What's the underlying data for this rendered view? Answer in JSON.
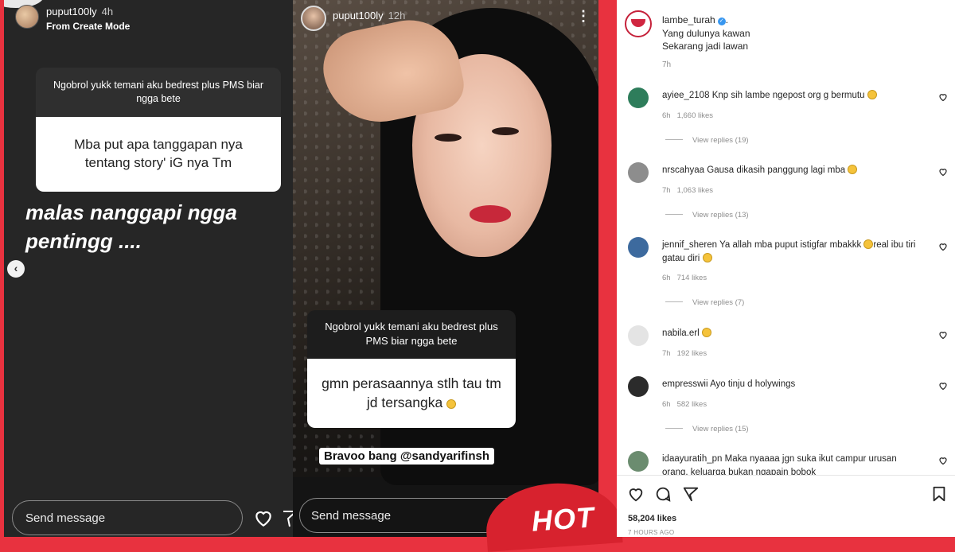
{
  "story_left": {
    "username": "puput100ly",
    "time": "4h",
    "subtitle": "From Create Mode",
    "question_prompt": "Ngobrol yukk temani aku bedrest plus PMS biar ngga bete",
    "question_answer": "Mba put apa tanggapan nya tentang story' iG nya Tm",
    "caption": "malas nanggapi ngga pentingg ....",
    "prev_arrow": "‹",
    "send_placeholder": "Send message"
  },
  "story_middle": {
    "username": "puput100ly",
    "time": "12h",
    "more": "⋮",
    "question_prompt": "Ngobrol yukk temani aku bedrest plus PMS biar ngga bete",
    "question_answer": "gmn perasaannya stlh tau tm jd tersangka",
    "mention": "Bravoo bang @sandyarifinsh",
    "send_placeholder": "Send message",
    "badge": "HOT"
  },
  "post": {
    "username": "lambe_turah",
    "verified_mark": "✓",
    "caption_dot": ".",
    "caption_lines": [
      "Yang dulunya kawan",
      "Sekarang jadi lawan"
    ],
    "time": "7h",
    "comments": [
      {
        "user": "ayiee_2108",
        "text": "Knp sih lambe ngepost org g bermutu",
        "emoji": true,
        "time": "6h",
        "likes": "1,660 likes",
        "replies": "View replies (19)",
        "avatar_color": "#2e7d5b"
      },
      {
        "user": "nrscahyaa",
        "text": "Gausa dikasih panggung lagi mba",
        "emoji": true,
        "time": "7h",
        "likes": "1,063 likes",
        "replies": "View replies (13)",
        "avatar_color": "#8d8d8d"
      },
      {
        "user": "jennif_sheren",
        "text": "Ya allah mba puput istigfar mbakkk",
        "text2": "real ibu tiri gatau diri",
        "emoji": true,
        "time": "6h",
        "likes": "714 likes",
        "replies": "View replies (7)",
        "avatar_color": "#3d6a9e"
      },
      {
        "user": "nabila.erl",
        "text": "",
        "emoji": true,
        "time": "7h",
        "likes": "192 likes",
        "replies": "",
        "avatar_color": "#e4e4e4"
      },
      {
        "user": "empresswii",
        "text": "Ayo tinju d holywings",
        "emoji": false,
        "time": "6h",
        "likes": "582 likes",
        "replies": "View replies (15)",
        "avatar_color": "#2b2b2b"
      },
      {
        "user": "idaayuratih_pn",
        "text": "Maka nyaaaa jgn suka ikut campur urusan",
        "text2": "orang, keluarga bukan ngapain bobok",
        "emoji": false,
        "time": "",
        "likes": "",
        "replies": "",
        "avatar_color": "#6b8c6f"
      }
    ],
    "likes_total": "58,204 likes",
    "posted": "7 HOURS AGO"
  },
  "colors": {
    "background": "#e8323f",
    "verified": "#3897f0"
  },
  "icons": [
    "heart-icon",
    "comment-icon",
    "share-icon",
    "bookmark-icon",
    "send-icon",
    "chevron-left-icon",
    "more-icon"
  ]
}
